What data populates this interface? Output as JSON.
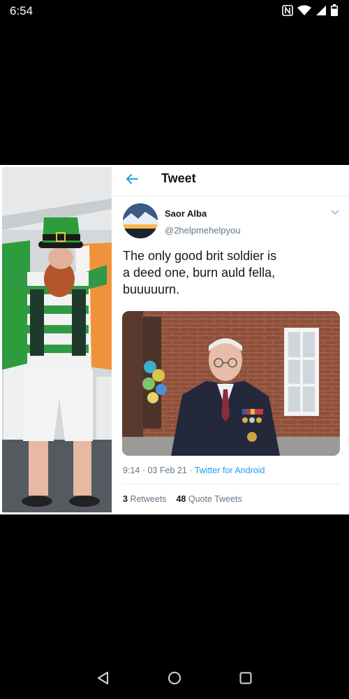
{
  "status_bar": {
    "time": "6:54",
    "icons": [
      "nfc-icon",
      "wifi-icon",
      "signal-icon",
      "battery-icon"
    ]
  },
  "tweet": {
    "header_title": "Tweet",
    "display_name": "Saor Alba",
    "handle": "@2helpmehelpyou",
    "text": "The only good brit soldier is\na deed one, burn auld fella,\nbuuuuurn.",
    "time": "9:14",
    "date": "03 Feb 21",
    "separator": "·",
    "source": "Twitter for Android",
    "retweets_count": "3",
    "retweets_label": "Retweets",
    "quote_count": "48",
    "quote_label": "Quote Tweets"
  },
  "nav_bar": {
    "buttons": [
      "back-triangle-icon",
      "home-circle-icon",
      "recents-square-icon"
    ]
  },
  "colors": {
    "twitter_blue": "#1da1f2",
    "secondary_text": "#657786",
    "primary_text": "#14171a",
    "background": "#000000"
  }
}
